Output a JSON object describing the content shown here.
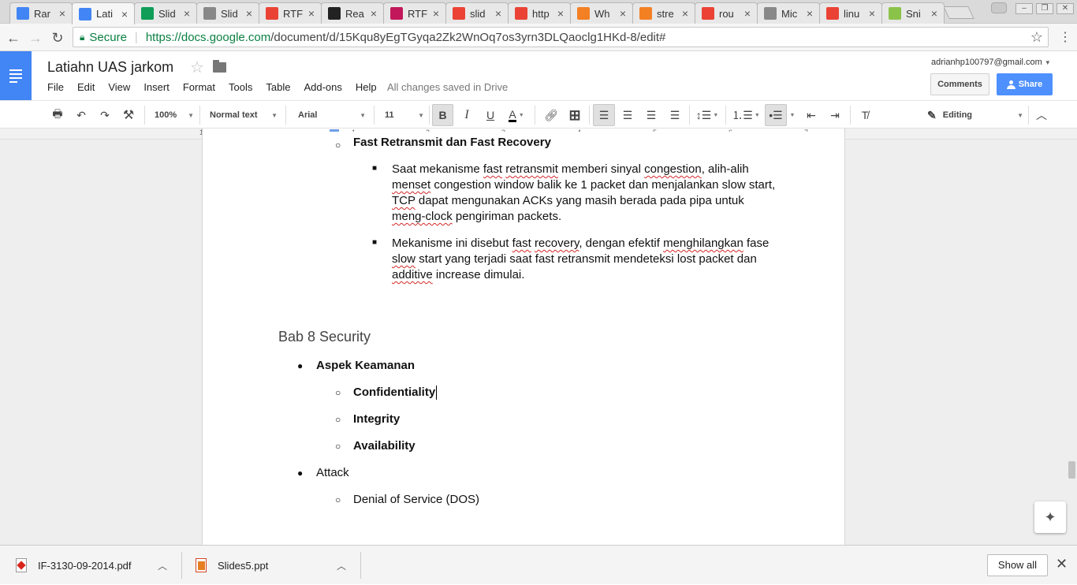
{
  "browser": {
    "tabs": [
      {
        "label": "Rar",
        "favicon": "docs-icon",
        "color": "#4285f4"
      },
      {
        "label": "Lati",
        "favicon": "docs-icon",
        "color": "#4285f4",
        "active": true
      },
      {
        "label": "Slid",
        "favicon": "drive-icon",
        "color": "#0f9d58"
      },
      {
        "label": "Slid",
        "favicon": "page-icon",
        "color": "#888888"
      },
      {
        "label": "RTF",
        "favicon": "google-icon",
        "color": "#ea4335"
      },
      {
        "label": "Rea",
        "favicon": "wikipedia-icon",
        "color": "#222222"
      },
      {
        "label": "RTF",
        "favicon": "pen-icon",
        "color": "#c2185b"
      },
      {
        "label": "slid",
        "favicon": "google-icon",
        "color": "#ea4335"
      },
      {
        "label": "http",
        "favicon": "google-icon",
        "color": "#ea4335"
      },
      {
        "label": "Wh",
        "favicon": "stackoverflow-icon",
        "color": "#f48024"
      },
      {
        "label": "stre",
        "favicon": "stackoverflow-icon",
        "color": "#f48024"
      },
      {
        "label": "rou",
        "favicon": "google-icon",
        "color": "#ea4335"
      },
      {
        "label": "Mic",
        "favicon": "page-icon",
        "color": "#888888"
      },
      {
        "label": "linu",
        "favicon": "google-icon",
        "color": "#ea4335"
      },
      {
        "label": "Sni",
        "favicon": "snippet-icon",
        "color": "#8bc34a"
      }
    ],
    "secure_label": "Secure",
    "url_host": "https://docs.google.com",
    "url_path": "/document/d/15Kqu8yEgTGyqa2Zk2WnOq7os3yrn3DLQaoclg1HKd-8/edit#"
  },
  "docs": {
    "title": "Latiahn UAS jarkom",
    "menu": [
      "File",
      "Edit",
      "View",
      "Insert",
      "Format",
      "Tools",
      "Table",
      "Add-ons",
      "Help"
    ],
    "save_status": "All changes saved in Drive",
    "account": "adrianhp100797@gmail.com",
    "comments_label": "Comments",
    "share_label": "Share"
  },
  "toolbar": {
    "zoom": "100%",
    "style": "Normal text",
    "font": "Arial",
    "size": "11",
    "mode": "Editing"
  },
  "ruler": [
    "1",
    "1",
    "2",
    "3",
    "4",
    "5",
    "6",
    "7"
  ],
  "document": {
    "sub_heading": "Fast Retransmit dan Fast Recovery",
    "para1": [
      [
        "Saat mekanisme ",
        "fast",
        " ",
        "retransmit",
        " memberi sinyal ",
        "congestion",
        ", alih-alih"
      ],
      [
        "menset",
        " ",
        "congestion",
        " ",
        "window",
        " balik ke 1 ",
        "packet",
        " dan menjalankan ",
        "slow",
        " ",
        "start",
        ","
      ],
      [
        "TCP",
        " dapat ",
        "mengunakan",
        " ",
        "ACKs",
        " yang masih berada pada pipa untuk"
      ],
      [
        "meng-clock",
        " pengiriman ",
        "packets",
        "."
      ]
    ],
    "para2": [
      [
        "Mekanisme ini disebut ",
        "fast",
        " ",
        "recovery",
        ", dengan efektif ",
        "menghilangkan",
        " fase"
      ],
      [
        "slow",
        " ",
        "start",
        " yang terjadi saat ",
        "fast",
        " ",
        "retransmit",
        " ",
        "mendeteksi",
        " ",
        "lost",
        " ",
        "packet",
        " dan"
      ],
      [
        "additive",
        " ",
        "increase",
        " dimulai."
      ]
    ],
    "heading": "Bab 8 Security",
    "item1": "Aspek Keamanan",
    "sub1": "Confidentiality",
    "sub2": "Integrity",
    "sub3": "Availability",
    "item2": "Attack",
    "sub4": "Denial of Service (DOS)"
  },
  "downloads": {
    "file1": "IF-3130-09-2014.pdf",
    "file2": "Slides5.ppt",
    "show_all": "Show all"
  }
}
